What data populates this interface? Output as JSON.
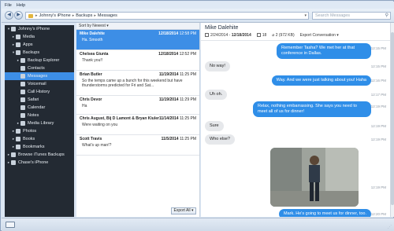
{
  "menubar": {
    "file": "File",
    "help": "Help"
  },
  "address": {
    "crumbs": [
      "Johnny's iPhone",
      "Backups",
      "Messages"
    ]
  },
  "search": {
    "placeholder": "Search Messages"
  },
  "sidebar": {
    "items": [
      {
        "label": "Johnny's iPhone",
        "indent": 0,
        "arrow": "▾",
        "icon": "phone-icon"
      },
      {
        "label": "Media",
        "indent": 1,
        "arrow": "▸",
        "icon": "music-icon"
      },
      {
        "label": "Apps",
        "indent": 1,
        "arrow": "▸",
        "icon": "apps-icon"
      },
      {
        "label": "Backups",
        "indent": 1,
        "arrow": "▾",
        "icon": "clock-icon"
      },
      {
        "label": "Backup Explorer",
        "indent": 2,
        "arrow": "▸",
        "icon": "folder-icon"
      },
      {
        "label": "Contacts",
        "indent": 2,
        "arrow": "",
        "icon": "contacts-icon"
      },
      {
        "label": "Messages",
        "indent": 2,
        "arrow": "",
        "icon": "messages-icon"
      },
      {
        "label": "Voicemail",
        "indent": 2,
        "arrow": "",
        "icon": "voicemail-icon"
      },
      {
        "label": "Call History",
        "indent": 2,
        "arrow": "",
        "icon": "phone-call-icon"
      },
      {
        "label": "Safari",
        "indent": 2,
        "arrow": "",
        "icon": "compass-icon"
      },
      {
        "label": "Calendar",
        "indent": 2,
        "arrow": "",
        "icon": "calendar-icon"
      },
      {
        "label": "Notes",
        "indent": 2,
        "arrow": "",
        "icon": "notes-icon"
      },
      {
        "label": "Media Library",
        "indent": 2,
        "arrow": "▸",
        "icon": "library-icon"
      },
      {
        "label": "Photos",
        "indent": 1,
        "arrow": "▸",
        "icon": "photos-icon"
      },
      {
        "label": "Books",
        "indent": 1,
        "arrow": "▸",
        "icon": "books-icon"
      },
      {
        "label": "Bookmarks",
        "indent": 1,
        "arrow": "▸",
        "icon": "bookmark-icon"
      },
      {
        "label": "Browse iTunes Backups",
        "indent": 0,
        "arrow": "▸",
        "icon": "itunes-icon"
      },
      {
        "label": "Chase's iPhone",
        "indent": 0,
        "arrow": "▸",
        "icon": "phone-icon"
      }
    ],
    "selected_index": 6
  },
  "list": {
    "sort_label": "Sort by Newest",
    "conversations": [
      {
        "name": "Mike Dalehite",
        "date": "12/18/2014",
        "time": "12:58 PM",
        "preview": "Ha. Smooth"
      },
      {
        "name": "Chelsea Giunta",
        "date": "12/18/2014",
        "time": "12:52 PM",
        "preview": "Thank you!!"
      },
      {
        "name": "Brian Butler",
        "date": "11/19/2014",
        "time": "11:25 PM",
        "preview": "So the temps came up a bunch for this weekend but have thunderstorms predicted for Fri and Sat..."
      },
      {
        "name": "Chris Devor",
        "date": "11/19/2014",
        "time": "11:29 PM",
        "preview": "Ha"
      },
      {
        "name": "Chris August, Bij D Lamont & Bryan Kiuler",
        "date": "11/14/2014",
        "time": "11:25 PM",
        "preview": "Were waiting on you"
      },
      {
        "name": "Scott Travis",
        "date": "11/5/2014",
        "time": "11:25 PM",
        "preview": "What's up man!?"
      }
    ],
    "export_all": "Export All"
  },
  "conversation": {
    "title": "Mike Dalehite",
    "date_range_start": "2/24/2014",
    "date_range_sep": " - ",
    "date_range_end": "12/18/2014",
    "message_count": "18",
    "attachments": "2 (972 KB)",
    "export_label": "Export Conversation",
    "messages": [
      {
        "dir": "out",
        "text": "Remember Tasha? We met her at that conference in Dallas.",
        "time": "12:15 PM"
      },
      {
        "dir": "in",
        "text": "No way!",
        "time": "12:15 PM"
      },
      {
        "dir": "out",
        "text": "Way. And we were just talking about you! Haha",
        "time": "12:16 PM"
      },
      {
        "dir": "in",
        "text": "Uh oh.",
        "time": "12:17 PM"
      },
      {
        "dir": "out",
        "text": "Relax, nothing embarrassing. She says you need to meet all of us for dinner!",
        "time": "12:19 PM"
      },
      {
        "dir": "in",
        "text": "Sure",
        "time": "12:19 PM"
      },
      {
        "dir": "in",
        "text": "Who else?",
        "time": "12:19 PM"
      },
      {
        "dir": "out",
        "text": "Mark. He's going to meet us for dinner, too.",
        "time": "12:20 PM"
      }
    ],
    "photo_time": "12:19 PM"
  },
  "colors": {
    "accent": "#3d8ee6",
    "sidebar_bg": "#232a33",
    "bubble_out": "#2f8ee8",
    "bubble_in": "#e6e8eb"
  }
}
